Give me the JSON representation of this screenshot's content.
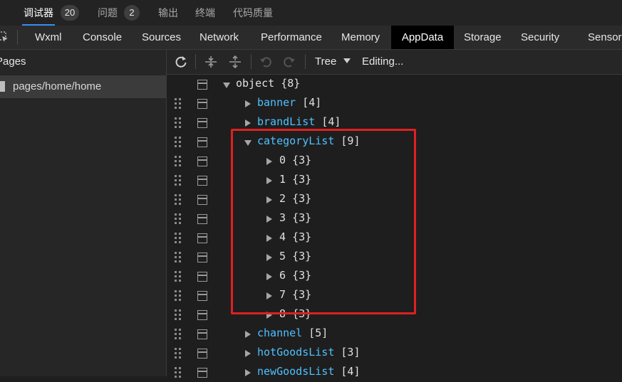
{
  "top_tabs": [
    {
      "label": "调试器",
      "badge": "20",
      "active": true
    },
    {
      "label": "问题",
      "badge": "2",
      "active": false
    },
    {
      "label": "输出",
      "active": false
    },
    {
      "label": "终端",
      "active": false
    },
    {
      "label": "代码质量",
      "active": false
    }
  ],
  "panel_tabs": [
    "Wxml",
    "Console",
    "Sources",
    "Network",
    "Performance",
    "Memory",
    "AppData",
    "Storage",
    "Security",
    "Sensor"
  ],
  "active_panel": "AppData",
  "sidebar": {
    "header": "Pages",
    "pages": [
      "pages/home/home"
    ]
  },
  "toolbar": {
    "view_mode": "Tree",
    "status": "Editing..."
  },
  "tree": {
    "root": {
      "key": "object",
      "count": "{8}"
    },
    "rows": [
      {
        "key": "banner",
        "count": "[4]",
        "expanded": false
      },
      {
        "key": "brandList",
        "count": "[4]",
        "expanded": false
      },
      {
        "key": "categoryList",
        "count": "[9]",
        "expanded": true
      },
      {
        "key": "0",
        "count": "{3}",
        "expanded": false
      },
      {
        "key": "1",
        "count": "{3}",
        "expanded": false
      },
      {
        "key": "2",
        "count": "{3}",
        "expanded": false
      },
      {
        "key": "3",
        "count": "{3}",
        "expanded": false
      },
      {
        "key": "4",
        "count": "{3}",
        "expanded": false
      },
      {
        "key": "5",
        "count": "{3}",
        "expanded": false
      },
      {
        "key": "6",
        "count": "{3}",
        "expanded": false
      },
      {
        "key": "7",
        "count": "{3}",
        "expanded": false
      },
      {
        "key": "8",
        "count": "{3}",
        "expanded": false
      },
      {
        "key": "channel",
        "count": "[5]",
        "expanded": false
      },
      {
        "key": "hotGoodsList",
        "count": "[3]",
        "expanded": false
      },
      {
        "key": "newGoodsList",
        "count": "[4]",
        "expanded": false
      }
    ]
  },
  "colors": {
    "highlight": "#e02020",
    "key": "#4fc1ff",
    "active_tab_underline": "#3a8ef0"
  }
}
